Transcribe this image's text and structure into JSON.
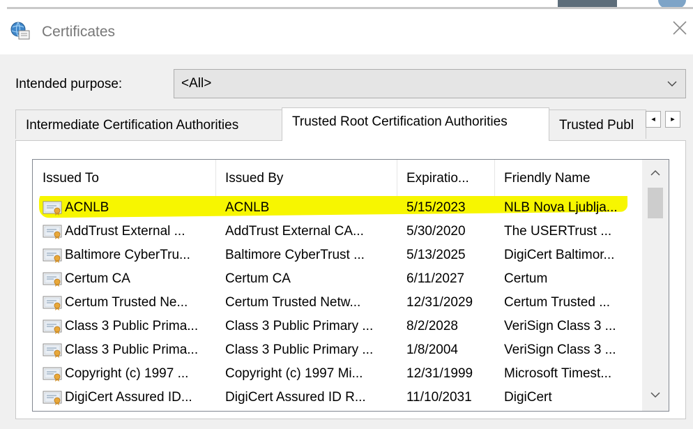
{
  "window": {
    "title": "Certificates",
    "close_glyph": "✕",
    "icon": "certificate-globe-icon"
  },
  "purpose": {
    "label": "Intended purpose:",
    "value": "<All>"
  },
  "tabs": [
    {
      "label": "Intermediate Certification Authorities",
      "active": false
    },
    {
      "label": "Trusted Root Certification Authorities",
      "active": true
    },
    {
      "label": "Trusted Publ",
      "active": false
    }
  ],
  "tab_scroll": {
    "left": "◂",
    "right": "▸"
  },
  "list": {
    "columns": [
      "Issued To",
      "Issued By",
      "Expiratio...",
      "Friendly Name"
    ],
    "rows": [
      {
        "issued_to": "ACNLB",
        "issued_by": "ACNLB",
        "expiration": "5/15/2023",
        "friendly": "NLB Nova Ljublja..."
      },
      {
        "issued_to": "AddTrust External ...",
        "issued_by": "AddTrust External CA...",
        "expiration": "5/30/2020",
        "friendly": "The USERTrust ..."
      },
      {
        "issued_to": "Baltimore CyberTru...",
        "issued_by": "Baltimore CyberTrust ...",
        "expiration": "5/13/2025",
        "friendly": "DigiCert Baltimor..."
      },
      {
        "issued_to": "Certum CA",
        "issued_by": "Certum CA",
        "expiration": "6/11/2027",
        "friendly": "Certum"
      },
      {
        "issued_to": "Certum Trusted Ne...",
        "issued_by": "Certum Trusted Netw...",
        "expiration": "12/31/2029",
        "friendly": "Certum Trusted ..."
      },
      {
        "issued_to": "Class 3 Public Prima...",
        "issued_by": "Class 3 Public Primary ...",
        "expiration": "8/2/2028",
        "friendly": "VeriSign Class 3 ..."
      },
      {
        "issued_to": "Class 3 Public Prima...",
        "issued_by": "Class 3 Public Primary ...",
        "expiration": "1/8/2004",
        "friendly": "VeriSign Class 3 ..."
      },
      {
        "issued_to": "Copyright (c) 1997 ...",
        "issued_by": "Copyright (c) 1997 Mi...",
        "expiration": "12/31/1999",
        "friendly": "Microsoft Timest..."
      },
      {
        "issued_to": "DigiCert Assured ID...",
        "issued_by": "DigiCert Assured ID R...",
        "expiration": "11/10/2031",
        "friendly": "DigiCert"
      }
    ],
    "highlighted_row": 0,
    "highlight_color": "#f7f600"
  },
  "colors": {
    "client_bg": "#f0f0f0",
    "highlight": "#f7f600"
  }
}
